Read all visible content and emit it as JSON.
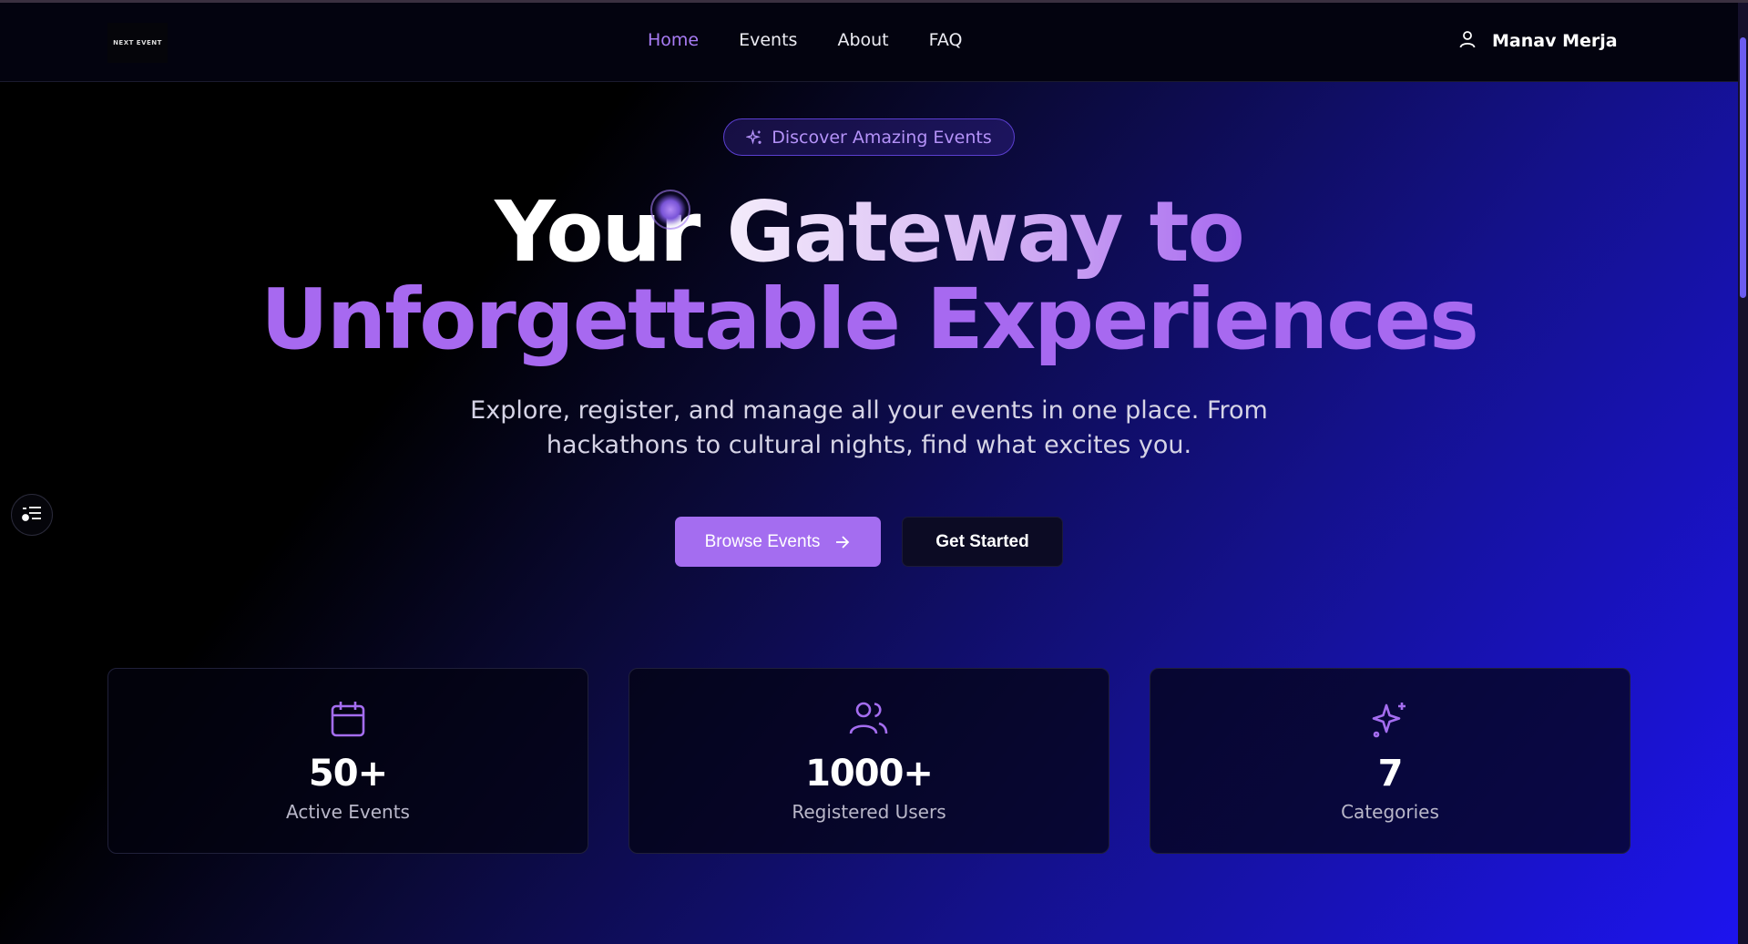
{
  "nav": {
    "logo_text": "NEXT EVENT",
    "links": [
      {
        "label": "Home",
        "active": true
      },
      {
        "label": "Events",
        "active": false
      },
      {
        "label": "About",
        "active": false
      },
      {
        "label": "FAQ",
        "active": false
      }
    ],
    "user_name": "Manav Merja",
    "user_icon": "user-icon"
  },
  "hero": {
    "badge": "Discover Amazing Events",
    "badge_icon": "sparkles-icon",
    "title_line1_white": "Your",
    "title_line1_grad": "Gateway to",
    "title_line2": "Unforgettable Experiences",
    "subtitle_line1": "Explore, register, and manage all your events in one place. From",
    "subtitle_line2": "hackathons to cultural nights, find what excites you.",
    "primary_button": "Browse Events",
    "secondary_button": "Get Started"
  },
  "stats": [
    {
      "icon": "calendar-icon",
      "value": "50+",
      "label": "Active Events"
    },
    {
      "icon": "users-icon",
      "value": "1000+",
      "label": "Registered Users"
    },
    {
      "icon": "sparkles-icon",
      "value": "7",
      "label": "Categories"
    }
  ],
  "colors": {
    "accent": "#a46df0",
    "nav_active": "#a87cf4",
    "background_dark": "#03030f",
    "background_blue": "#1d14f0"
  }
}
